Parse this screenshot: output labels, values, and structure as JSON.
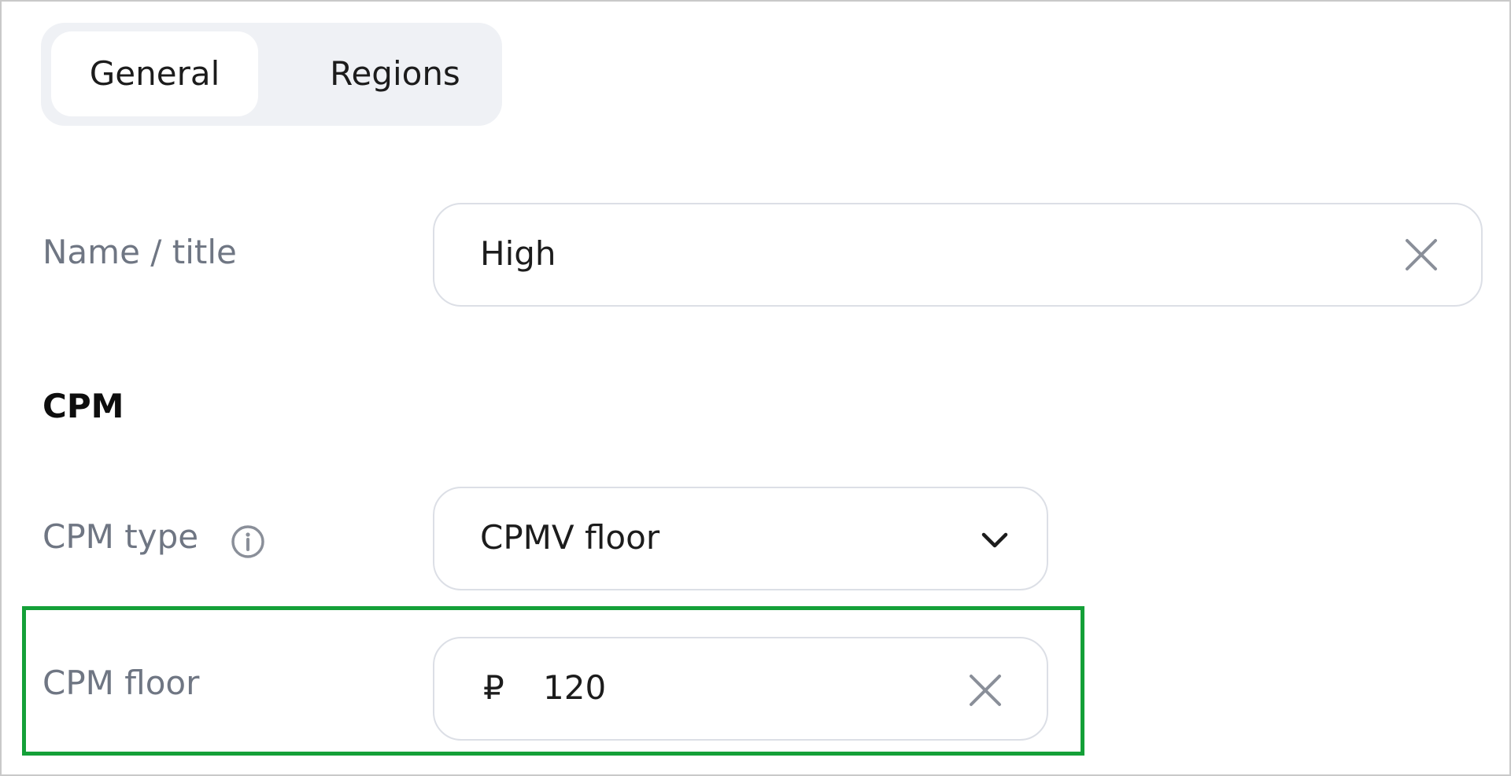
{
  "tabs": [
    {
      "label": "General",
      "active": true
    },
    {
      "label": "Regions",
      "active": false
    }
  ],
  "name_field": {
    "label": "Name / title",
    "value": "High"
  },
  "section": {
    "title": "CPM"
  },
  "cpm_type": {
    "label": "CPM type",
    "selected": "CPMV floor"
  },
  "cpm_floor": {
    "label": "CPM floor",
    "currency_symbol": "₽",
    "value": "120"
  },
  "colors": {
    "highlight": "#14a038",
    "tab_bg": "#eff1f5",
    "label": "#6f7683"
  },
  "icons": {
    "clear": "close-icon",
    "info": "info-icon",
    "dropdown": "chevron-down-icon"
  }
}
